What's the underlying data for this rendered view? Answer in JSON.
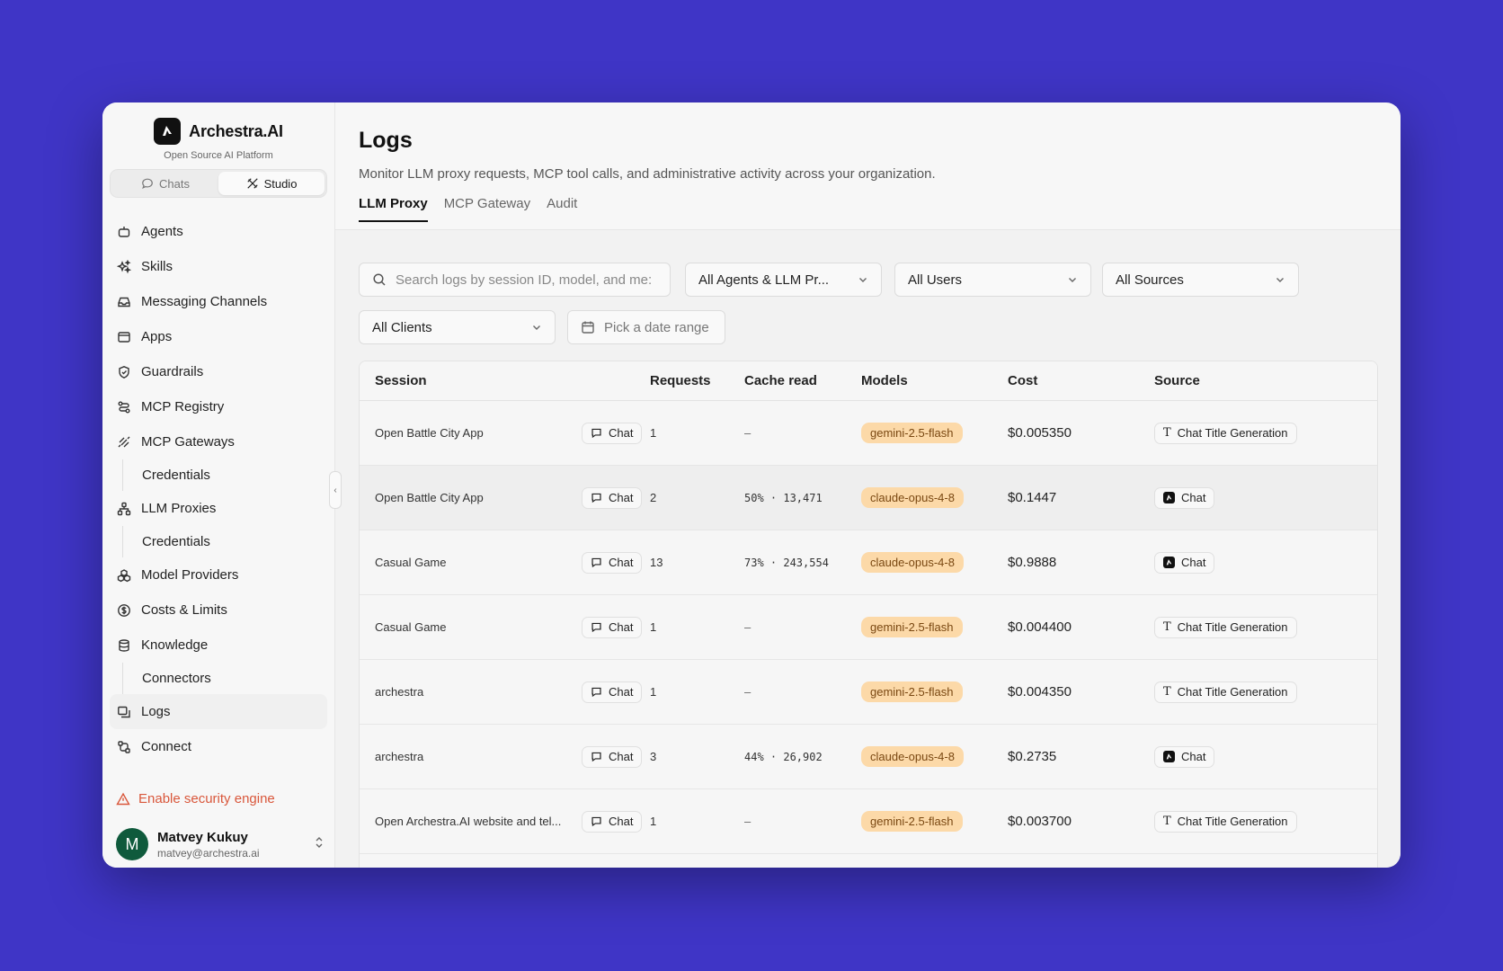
{
  "brand": {
    "name": "Archestra.AI",
    "subtitle": "Open Source AI Platform"
  },
  "mode_switch": {
    "chats_label": "Chats",
    "studio_label": "Studio"
  },
  "sidebar": {
    "items": [
      {
        "label": "Agents",
        "icon": "bot-icon"
      },
      {
        "label": "Skills",
        "icon": "sparkles-icon"
      },
      {
        "label": "Messaging Channels",
        "icon": "inbox-icon"
      },
      {
        "label": "Apps",
        "icon": "window-icon"
      },
      {
        "label": "Guardrails",
        "icon": "shield-icon"
      },
      {
        "label": "MCP Registry",
        "icon": "route-icon"
      },
      {
        "label": "MCP Gateways",
        "icon": "gateway-icon"
      },
      {
        "label": "Credentials",
        "sub": true
      },
      {
        "label": "LLM Proxies",
        "icon": "network-icon"
      },
      {
        "label": "Credentials",
        "sub": true
      },
      {
        "label": "Model Providers",
        "icon": "boxes-icon"
      },
      {
        "label": "Costs & Limits",
        "icon": "dollar-icon"
      },
      {
        "label": "Knowledge",
        "icon": "database-icon"
      },
      {
        "label": "Connectors",
        "sub": true
      },
      {
        "label": "Logs",
        "icon": "logs-icon",
        "active": true
      },
      {
        "label": "Connect",
        "icon": "connect-icon"
      }
    ],
    "security_label": "Enable security engine",
    "user": {
      "initial": "M",
      "name": "Matvey Kukuy",
      "email": "matvey@archestra.ai"
    }
  },
  "page": {
    "title": "Logs",
    "description": "Monitor LLM proxy requests, MCP tool calls, and administrative activity across your organization."
  },
  "tabs": [
    "LLM Proxy",
    "MCP Gateway",
    "Audit"
  ],
  "filters": {
    "search_placeholder": "Search logs by session ID, model, and me:",
    "agents": "All Agents & LLM Pr...",
    "users": "All Users",
    "sources": "All Sources",
    "clients": "All Clients",
    "date": "Pick a date range"
  },
  "table": {
    "headers": [
      "Session",
      "Requests",
      "Cache read",
      "Models",
      "Cost",
      "Source"
    ],
    "rows": [
      {
        "session": "Open Battle City App",
        "type": "Chat",
        "requests": "1",
        "cache": "—",
        "model": "gemini-2.5-flash",
        "cost": "$0.005350",
        "source": "Chat Title Generation",
        "source_icon": "text-icon"
      },
      {
        "session": "Open Battle City App",
        "type": "Chat",
        "requests": "2",
        "cache": "50% · 13,471",
        "model": "claude-opus-4-8",
        "cost": "$0.1447",
        "source": "Chat",
        "source_icon": "app-logo-icon"
      },
      {
        "session": "Casual Game",
        "type": "Chat",
        "requests": "13",
        "cache": "73% · 243,554",
        "model": "claude-opus-4-8",
        "cost": "$0.9888",
        "source": "Chat",
        "source_icon": "app-logo-icon"
      },
      {
        "session": "Casual Game",
        "type": "Chat",
        "requests": "1",
        "cache": "—",
        "model": "gemini-2.5-flash",
        "cost": "$0.004400",
        "source": "Chat Title Generation",
        "source_icon": "text-icon"
      },
      {
        "session": "archestra",
        "type": "Chat",
        "requests": "1",
        "cache": "—",
        "model": "gemini-2.5-flash",
        "cost": "$0.004350",
        "source": "Chat Title Generation",
        "source_icon": "text-icon"
      },
      {
        "session": "archestra",
        "type": "Chat",
        "requests": "3",
        "cache": "44% · 26,902",
        "model": "claude-opus-4-8",
        "cost": "$0.2735",
        "source": "Chat",
        "source_icon": "app-logo-icon"
      },
      {
        "session": "Open Archestra.AI website and tel...",
        "type": "Chat",
        "requests": "1",
        "cache": "—",
        "model": "gemini-2.5-flash",
        "cost": "$0.003700",
        "source": "Chat Title Generation",
        "source_icon": "text-icon"
      }
    ]
  },
  "colors": {
    "background": "#3f35c6",
    "model_pill": "#fcd9a8",
    "warning": "#d9573b",
    "avatar": "#0f5a3c"
  }
}
